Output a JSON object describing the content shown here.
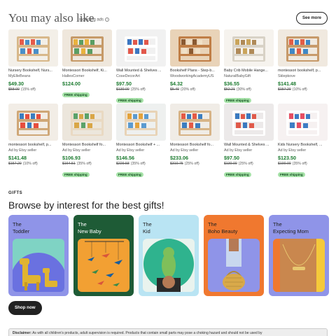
{
  "section": {
    "title": "You may also like",
    "subtitle": "including ads",
    "see_more": "See more"
  },
  "products": [
    {
      "title": "Nursery Bookshelf, Nurs...",
      "seller": "MyElleBeans",
      "price": "$49.30",
      "orig": "$58.00",
      "discount": "(15% off)",
      "free_shipping": ""
    },
    {
      "title": "Montessori Bookshelf, Ki...",
      "seller": "HallesCorner",
      "price": "$124.00",
      "orig": "",
      "discount": "",
      "free_shipping": "FREE shipping"
    },
    {
      "title": "Wall Mounted & Shelves ...",
      "seller": "CoseDecorArt",
      "price": "$97.50",
      "orig": "$130.00",
      "discount": "(25% off)",
      "free_shipping": "FREE shipping"
    },
    {
      "title": "Bookshelf Plans - Step-b...",
      "seller": "WoodworkingAcademyUS",
      "price": "$4.32",
      "orig": "$5.40",
      "discount": "(20% off)",
      "free_shipping": ""
    },
    {
      "title": "Baby Crib Mobile Hange...",
      "seller": "NaturalBabyGift",
      "price": "$36.55",
      "orig": "$52.21",
      "discount": "(30% off)",
      "free_shipping": "FREE shipping"
    },
    {
      "title": "montessori bookshelf, p...",
      "seller": "Sklepkove",
      "price": "$141.48",
      "orig": "$157.20",
      "discount": "(10% off)",
      "free_shipping": ""
    },
    {
      "title": "montessori bookshelf, p...",
      "seller": "Ad by Etsy seller",
      "price": "$141.48",
      "orig": "$157.20",
      "discount": "(10% off)",
      "free_shipping": ""
    },
    {
      "title": "Montessori Bookshelf fo...",
      "seller": "Ad by Etsy seller",
      "price": "$106.93",
      "orig": "$164.51",
      "discount": "(35% off)",
      "free_shipping": "FREE shipping"
    },
    {
      "title": "Montessori Bookshelf + ...",
      "seller": "Ad by Etsy seller",
      "price": "$146.56",
      "orig": "$229.58",
      "discount": "(35% off)",
      "free_shipping": "FREE shipping"
    },
    {
      "title": "Montessori Bookshelf fo...",
      "seller": "Ad by Etsy seller",
      "price": "$233.06",
      "orig": "$310.75",
      "discount": "(25% off)",
      "free_shipping": ""
    },
    {
      "title": "Wall Mounted & Shelves ...",
      "seller": "Ad by Etsy seller",
      "price": "$97.50",
      "orig": "$130.00",
      "discount": "(25% off)",
      "free_shipping": "FREE shipping"
    },
    {
      "title": "Kids Nursery Bookshelf, ...",
      "seller": "Ad by Etsy seller",
      "price": "$123.50",
      "orig": "$190.00",
      "discount": "(35% off)",
      "free_shipping": "FREE shipping"
    }
  ],
  "gifts": {
    "label": "GIFTS",
    "title": "Browse by interest for the best gifts!",
    "cards": [
      {
        "line1": "The",
        "line2": "Toddler",
        "bg": "#8f94e8"
      },
      {
        "line1": "The",
        "line2": "New Baby",
        "bg": "#1e5b36"
      },
      {
        "line1": "The",
        "line2": "Kid",
        "bg": "#b9e4f3"
      },
      {
        "line1": "The",
        "line2": "Boho Beauty",
        "bg": "#f0782f"
      },
      {
        "line1": "The",
        "line2": "Expecting Mom",
        "bg": "#8f94e8"
      }
    ],
    "shop_now": "Shop now"
  },
  "disclaimer": {
    "bold": "Disclaimer:",
    "text": "As with all children's products, adult supervision is required. Products that contain small parts may pose a choking hazard and should not be used by"
  },
  "colors": {
    "price": "#1a7a2e",
    "free_shipping_bg": "#a6e2a8",
    "button_dark": "#222222"
  }
}
